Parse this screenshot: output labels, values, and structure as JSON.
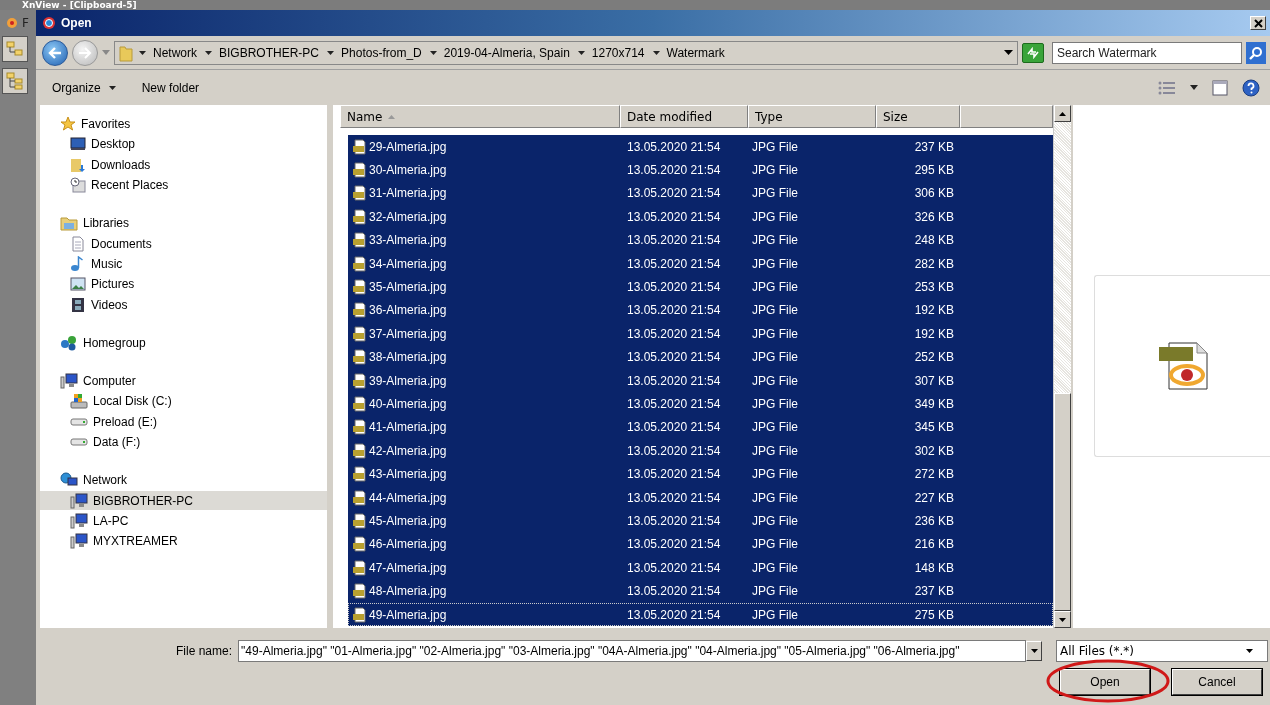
{
  "app": {
    "title": "XnView - [Clipboard-5]",
    "menu": [
      "F"
    ]
  },
  "dialog": {
    "title": "Open"
  },
  "address": {
    "segments": [
      "Network",
      "BIGBROTHER-PC",
      "Photos-from_D",
      "2019-04-Almeria, Spain",
      "1270x714",
      "Watermark"
    ]
  },
  "search": {
    "placeholder": "Search Watermark"
  },
  "toolbar": {
    "buttons": [
      "Organize",
      "New folder"
    ]
  },
  "nav": [
    {
      "label": "Favorites",
      "selected": false,
      "children": [
        {
          "label": "Desktop",
          "selected": false
        },
        {
          "label": "Downloads",
          "selected": false
        },
        {
          "label": "Recent Places",
          "selected": false
        }
      ]
    },
    {
      "label": "Libraries",
      "selected": false,
      "children": [
        {
          "label": "Documents",
          "selected": false
        },
        {
          "label": "Music",
          "selected": false
        },
        {
          "label": "Pictures",
          "selected": false
        },
        {
          "label": "Videos",
          "selected": false
        }
      ]
    },
    {
      "label": "Homegroup",
      "selected": false
    },
    {
      "label": "Computer",
      "selected": false,
      "children": [
        {
          "label": "Local Disk (C:)",
          "selected": false
        },
        {
          "label": "Preload (E:)",
          "selected": false
        },
        {
          "label": "Data (F:)",
          "selected": false
        }
      ]
    },
    {
      "label": "Network",
      "selected": false,
      "children": [
        {
          "label": "BIGBROTHER-PC",
          "selected": true
        },
        {
          "label": "LA-PC",
          "selected": false
        },
        {
          "label": "MYXTREAMER",
          "selected": false
        }
      ]
    }
  ],
  "table": {
    "columns": [
      "Name",
      "Date modified",
      "Type",
      "Size"
    ],
    "rows": [
      {
        "name": "29-Almeria.jpg",
        "date": "13.05.2020 21:54",
        "type": "JPG File",
        "size": "237 KB",
        "selected": true
      },
      {
        "name": "30-Almeria.jpg",
        "date": "13.05.2020 21:54",
        "type": "JPG File",
        "size": "295 KB",
        "selected": true
      },
      {
        "name": "31-Almeria.jpg",
        "date": "13.05.2020 21:54",
        "type": "JPG File",
        "size": "306 KB",
        "selected": true
      },
      {
        "name": "32-Almeria.jpg",
        "date": "13.05.2020 21:54",
        "type": "JPG File",
        "size": "326 KB",
        "selected": true
      },
      {
        "name": "33-Almeria.jpg",
        "date": "13.05.2020 21:54",
        "type": "JPG File",
        "size": "248 KB",
        "selected": true
      },
      {
        "name": "34-Almeria.jpg",
        "date": "13.05.2020 21:54",
        "type": "JPG File",
        "size": "282 KB",
        "selected": true
      },
      {
        "name": "35-Almeria.jpg",
        "date": "13.05.2020 21:54",
        "type": "JPG File",
        "size": "253 KB",
        "selected": true
      },
      {
        "name": "36-Almeria.jpg",
        "date": "13.05.2020 21:54",
        "type": "JPG File",
        "size": "192 KB",
        "selected": true
      },
      {
        "name": "37-Almeria.jpg",
        "date": "13.05.2020 21:54",
        "type": "JPG File",
        "size": "192 KB",
        "selected": true
      },
      {
        "name": "38-Almeria.jpg",
        "date": "13.05.2020 21:54",
        "type": "JPG File",
        "size": "252 KB",
        "selected": true
      },
      {
        "name": "39-Almeria.jpg",
        "date": "13.05.2020 21:54",
        "type": "JPG File",
        "size": "307 KB",
        "selected": true
      },
      {
        "name": "40-Almeria.jpg",
        "date": "13.05.2020 21:54",
        "type": "JPG File",
        "size": "349 KB",
        "selected": true
      },
      {
        "name": "41-Almeria.jpg",
        "date": "13.05.2020 21:54",
        "type": "JPG File",
        "size": "345 KB",
        "selected": true
      },
      {
        "name": "42-Almeria.jpg",
        "date": "13.05.2020 21:54",
        "type": "JPG File",
        "size": "302 KB",
        "selected": true
      },
      {
        "name": "43-Almeria.jpg",
        "date": "13.05.2020 21:54",
        "type": "JPG File",
        "size": "272 KB",
        "selected": true
      },
      {
        "name": "44-Almeria.jpg",
        "date": "13.05.2020 21:54",
        "type": "JPG File",
        "size": "227 KB",
        "selected": true
      },
      {
        "name": "45-Almeria.jpg",
        "date": "13.05.2020 21:54",
        "type": "JPG File",
        "size": "236 KB",
        "selected": true
      },
      {
        "name": "46-Almeria.jpg",
        "date": "13.05.2020 21:54",
        "type": "JPG File",
        "size": "216 KB",
        "selected": true
      },
      {
        "name": "47-Almeria.jpg",
        "date": "13.05.2020 21:54",
        "type": "JPG File",
        "size": "148 KB",
        "selected": true
      },
      {
        "name": "48-Almeria.jpg",
        "date": "13.05.2020 21:54",
        "type": "JPG File",
        "size": "237 KB",
        "selected": true
      },
      {
        "name": "49-Almeria.jpg",
        "date": "13.05.2020 21:54",
        "type": "JPG File",
        "size": "275 KB",
        "selected": true
      }
    ]
  },
  "file_name": {
    "label": "File name:",
    "value": "\"49-Almeria.jpg\" \"01-Almeria.jpg\" \"02-Almeria.jpg\" \"03-Almeria.jpg\" \"04A-Almeria.jpg\" \"04-Almeria.jpg\" \"05-Almeria.jpg\" \"06-Almeria.jpg\""
  },
  "file_type": {
    "value": "All Files (*.*)"
  },
  "buttons": [
    "Open",
    "Cancel"
  ]
}
